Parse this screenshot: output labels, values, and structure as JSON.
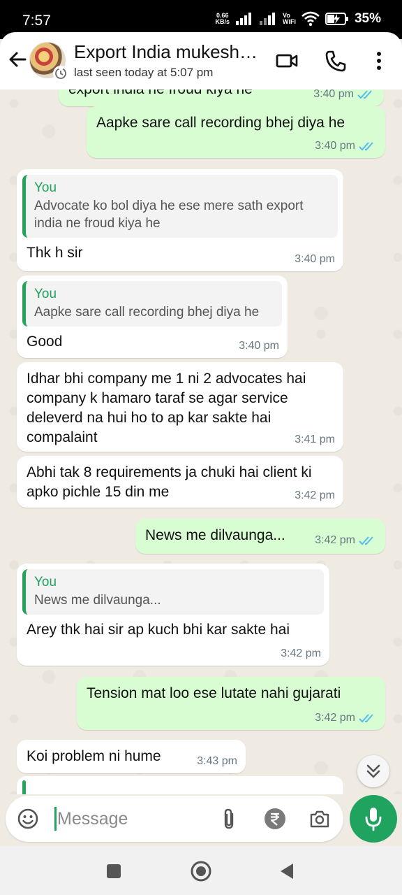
{
  "status_bar": {
    "time": "7:57",
    "net_speed_value": "0.66",
    "net_speed_unit": "KB/s",
    "vowifi_top": "Vo",
    "vowifi_bottom": "WiFi",
    "battery_percent": "35%"
  },
  "header": {
    "contact_name": "Export India mukesh…",
    "last_seen": "last seen today at 5:07 pm",
    "icons": [
      "back-arrow-icon",
      "video-call-icon",
      "phone-icon",
      "more-vert-icon"
    ]
  },
  "messages": [
    {
      "dir": "out",
      "text": "export india ne froud kiya he",
      "time": "3:40 pm",
      "ticks": "read"
    },
    {
      "dir": "out",
      "text": "Aapke sare call recording bhej diya he",
      "time": "3:40 pm",
      "ticks": "read"
    },
    {
      "dir": "in",
      "quote_author": "You",
      "quote_text": "Advocate ko bol diya he ese mere sath export india ne froud kiya he",
      "text": "Thk h sir",
      "time": "3:40 pm"
    },
    {
      "dir": "in",
      "quote_author": "You",
      "quote_text": "Aapke sare call recording bhej diya he",
      "text": "Good",
      "time": "3:40 pm"
    },
    {
      "dir": "in",
      "text": "Idhar bhi company me 1 ni 2 advocates hai company k hamaro taraf se agar service deleverd na hui ho to ap kar sakte hai compalaint",
      "time": "3:41 pm"
    },
    {
      "dir": "in",
      "text": "Abhi tak 8 requirements ja chuki hai client ki apko pichle 15 din me",
      "time": "3:42 pm"
    },
    {
      "dir": "out",
      "text": "News me dilvaunga...",
      "time": "3:42 pm",
      "ticks": "read"
    },
    {
      "dir": "in",
      "quote_author": "You",
      "quote_text": "News me dilvaunga...",
      "text": "Arey thk hai sir ap kuch bhi kar sakte hai",
      "time": "3:42 pm"
    },
    {
      "dir": "out",
      "text": "Tension mat loo ese lutate nahi gujarati",
      "time": "3:42 pm",
      "ticks": "read"
    },
    {
      "dir": "in",
      "text": "Koi problem ni hume",
      "time": "3:43 pm"
    }
  ],
  "composer": {
    "placeholder": "Message",
    "icons": [
      "emoji-icon",
      "attach-icon",
      "rupee-payment-icon",
      "camera-icon",
      "mic-icon"
    ]
  },
  "colors": {
    "outgoing_bubble": "#d9fdd3",
    "incoming_bubble": "#ffffff",
    "accent_green": "#1fa35e",
    "read_tick_blue": "#53bdeb",
    "chat_background": "#efeae2"
  }
}
